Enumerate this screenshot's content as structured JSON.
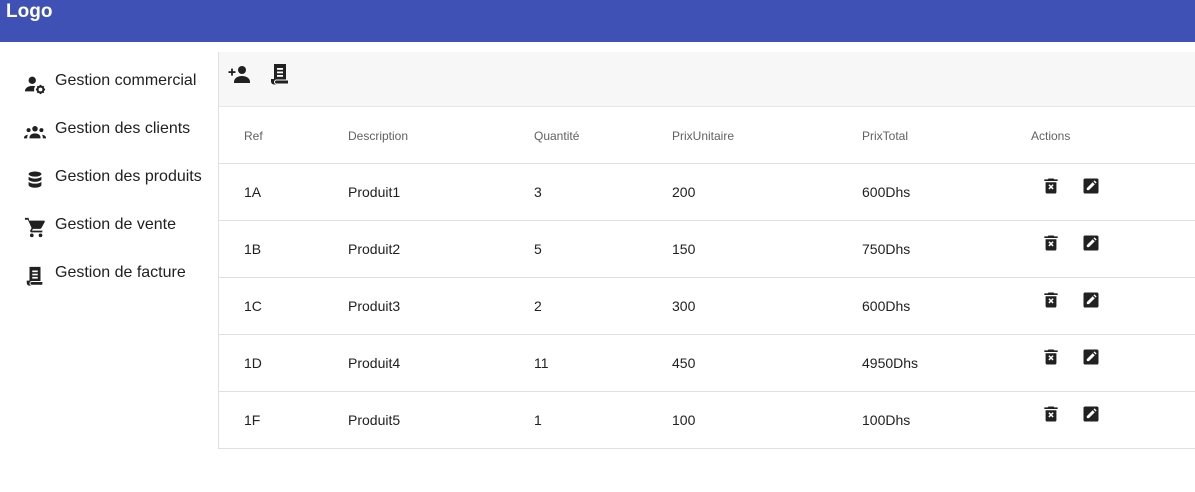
{
  "header": {
    "logo": "Logo",
    "bar_color": "#3f51b5"
  },
  "sidebar": {
    "items": [
      {
        "label": "Gestion commercial",
        "icon": "manage-accounts-icon"
      },
      {
        "label": "Gestion des clients",
        "icon": "people-icon"
      },
      {
        "label": "Gestion des produits",
        "icon": "database-icon"
      },
      {
        "label": "Gestion de vente",
        "icon": "cart-icon"
      },
      {
        "label": "Gestion de facture",
        "icon": "invoice-icon"
      }
    ]
  },
  "toolbar": {
    "buttons": [
      {
        "icon": "add-person-icon"
      },
      {
        "icon": "invoice-icon"
      }
    ]
  },
  "table": {
    "columns": [
      "Ref",
      "Description",
      "Quantité",
      "PrixUnitaire",
      "PrixTotal",
      "Actions"
    ],
    "rows": [
      {
        "ref": "1A",
        "description": "Produit1",
        "quantite": "3",
        "prix_unitaire": "200",
        "prix_total": "600Dhs"
      },
      {
        "ref": "1B",
        "description": "Produit2",
        "quantite": "5",
        "prix_unitaire": "150",
        "prix_total": "750Dhs"
      },
      {
        "ref": "1C",
        "description": "Produit3",
        "quantite": "2",
        "prix_unitaire": "300",
        "prix_total": "600Dhs"
      },
      {
        "ref": "1D",
        "description": "Produit4",
        "quantite": "11",
        "prix_unitaire": "450",
        "prix_total": "4950Dhs"
      },
      {
        "ref": "1F",
        "description": "Produit5",
        "quantite": "1",
        "prix_unitaire": "100",
        "prix_total": "100Dhs"
      }
    ],
    "row_actions": [
      {
        "icon": "delete-icon"
      },
      {
        "icon": "edit-icon"
      }
    ]
  }
}
